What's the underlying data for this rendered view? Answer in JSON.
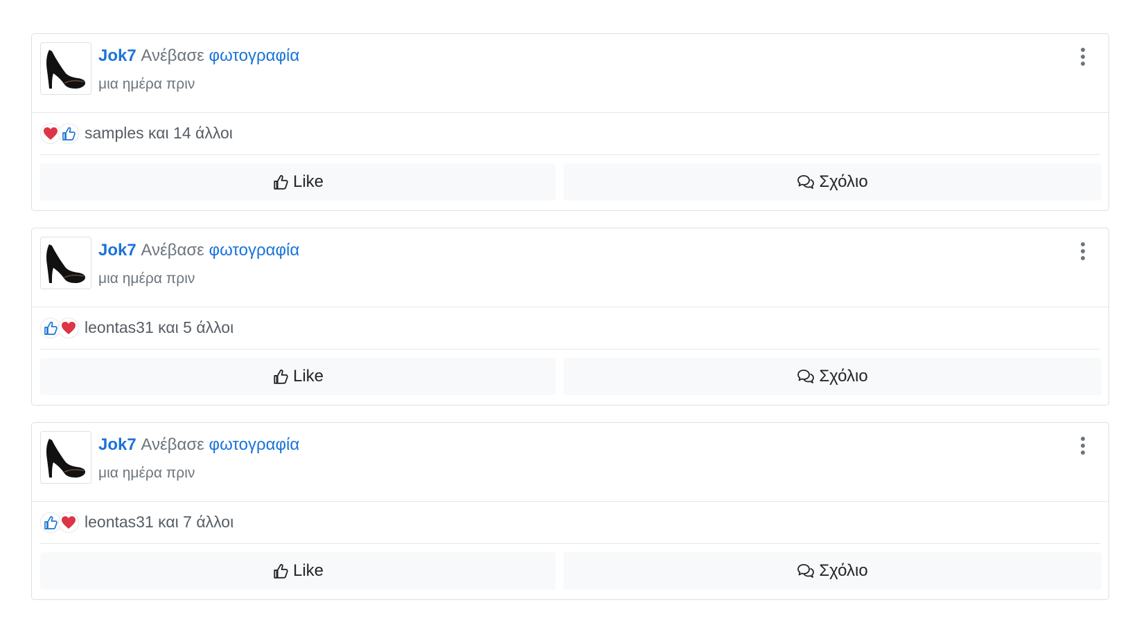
{
  "posts": [
    {
      "author": "Jok7",
      "action": "Ανέβασε",
      "target": "φωτογραφία",
      "time": "μια ημέρα πριν",
      "reaction_icons": [
        "heart-icon",
        "thumbs-up-icon"
      ],
      "reaction_text": "samples και 14 άλλοι",
      "like_label": "Like",
      "comment_label": "Σχόλιο"
    },
    {
      "author": "Jok7",
      "action": "Ανέβασε",
      "target": "φωτογραφία",
      "time": "μια ημέρα πριν",
      "reaction_icons": [
        "thumbs-up-icon",
        "heart-icon"
      ],
      "reaction_text": "leontas31 και 5 άλλοι",
      "like_label": "Like",
      "comment_label": "Σχόλιο"
    },
    {
      "author": "Jok7",
      "action": "Ανέβασε",
      "target": "φωτογραφία",
      "time": "μια ημέρα πριν",
      "reaction_icons": [
        "thumbs-up-icon",
        "heart-icon"
      ],
      "reaction_text": "leontas31 και 7 άλλοι",
      "like_label": "Like",
      "comment_label": "Σχόλιο"
    }
  ],
  "colors": {
    "link": "#1a73d9",
    "muted": "#6c757d",
    "heart": "#dc3545",
    "button_bg": "#f8f9fa",
    "border": "#dcdfe3"
  }
}
